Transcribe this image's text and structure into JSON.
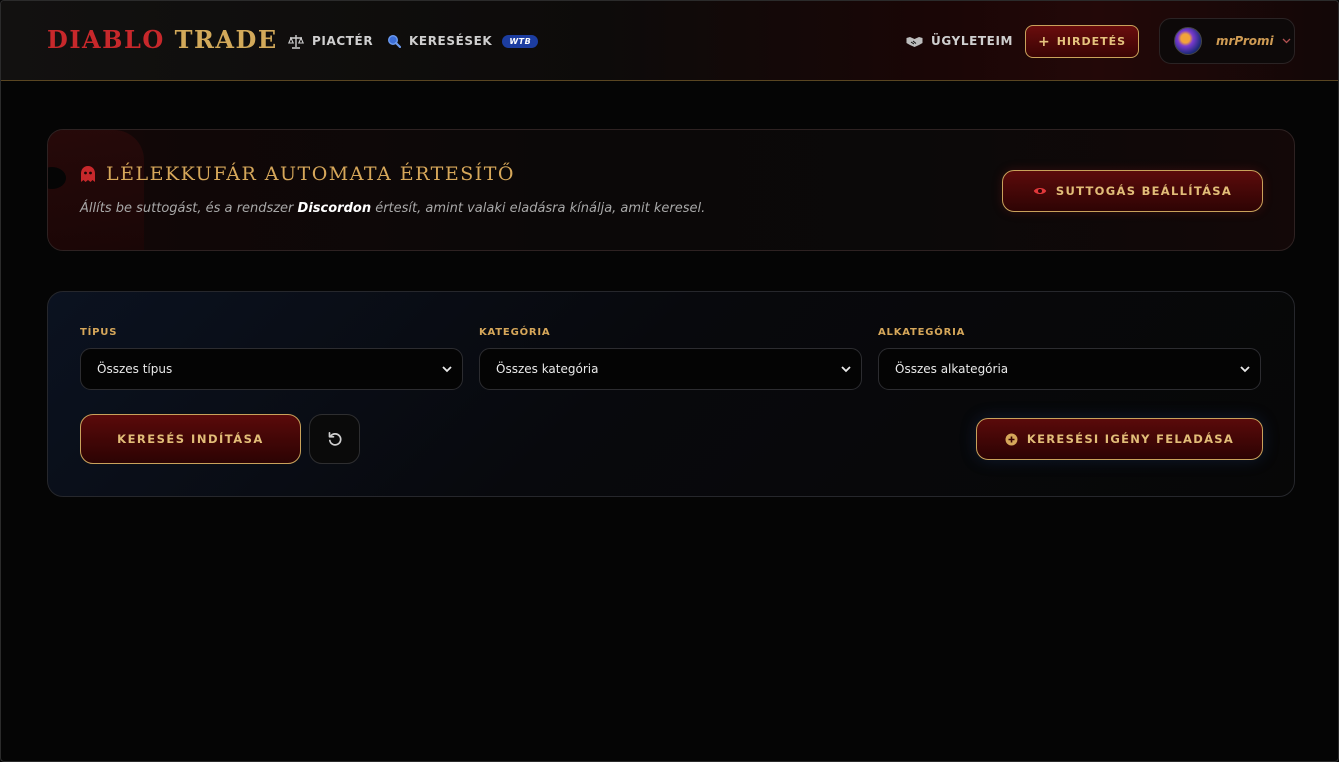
{
  "header": {
    "logo_part1": "DIABLO",
    "logo_part2": "TRADE",
    "nav": {
      "market_label": "PIACTÉR",
      "market_icon": "scale-icon",
      "searches_label": "KERESÉSEK",
      "searches_icon": "search-icon",
      "searches_badge": "WTB",
      "deals_label": "ÜGYLETEIM",
      "deals_icon": "handshake-icon"
    },
    "post_button_label": "HIRDETÉS",
    "user": {
      "name": "mrPromi"
    }
  },
  "banner": {
    "title": "LÉLEKKUFÁR AUTOMATA ÉRTESÍTŐ",
    "subtitle_before": "Állíts be suttogást, és a rendszer ",
    "subtitle_bold": "Discordon",
    "subtitle_after": " értesít, amint valaki eladásra kínálja, amit keresel.",
    "button_label": "SUTTOGÁS BEÁLLÍTÁSA"
  },
  "filters": {
    "type_label": "TÍPUS",
    "type_value": "Összes típus",
    "category_label": "KATEGÓRIA",
    "category_value": "Összes kategória",
    "subcategory_label": "ALKATEGÓRIA",
    "subcategory_value": "Összes alkategória",
    "search_button_label": "KERESÉS INDÍTÁSA",
    "request_button_label": "KERESÉSI IGÉNY FELADÁSA"
  },
  "colors": {
    "gold": "#d6a75a",
    "crimson": "#c7282b",
    "badge_blue": "#1c3da0"
  }
}
